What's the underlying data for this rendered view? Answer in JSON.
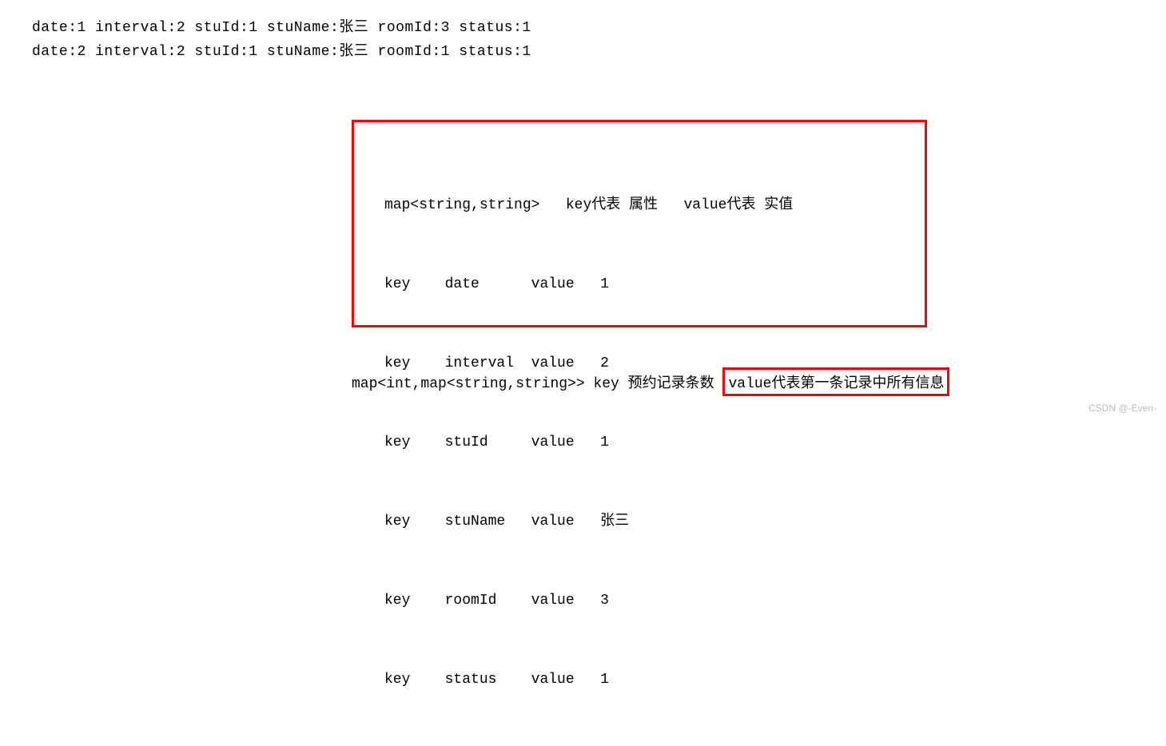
{
  "top": {
    "line1": "date:1 interval:2 stuId:1 stuName:张三 roomId:3 status:1",
    "line2": "date:2 interval:2 stuId:1 stuName:张三 roomId:1 status:1"
  },
  "box": {
    "header": "map<string,string>   key代表 属性   value代表 实值",
    "rows": [
      {
        "c1": "key",
        "c2": "date",
        "c3": "value",
        "c4": "1"
      },
      {
        "c1": "key",
        "c2": "interval",
        "c3": "value",
        "c4": "2"
      },
      {
        "c1": "key",
        "c2": "stuId",
        "c3": "value",
        "c4": "1"
      },
      {
        "c1": "key",
        "c2": "stuName",
        "c3": "value",
        "c4": "张三"
      },
      {
        "c1": "key",
        "c2": "roomId",
        "c3": "value",
        "c4": "3"
      },
      {
        "c1": "key",
        "c2": "status",
        "c3": "value",
        "c4": "1"
      }
    ]
  },
  "bottom": {
    "prefix": "map<int,map<string,string>>  key 预约记录条数 ",
    "boxed": "value代表第一条记录中所有信息"
  },
  "watermark": "CSDN @-Even-"
}
